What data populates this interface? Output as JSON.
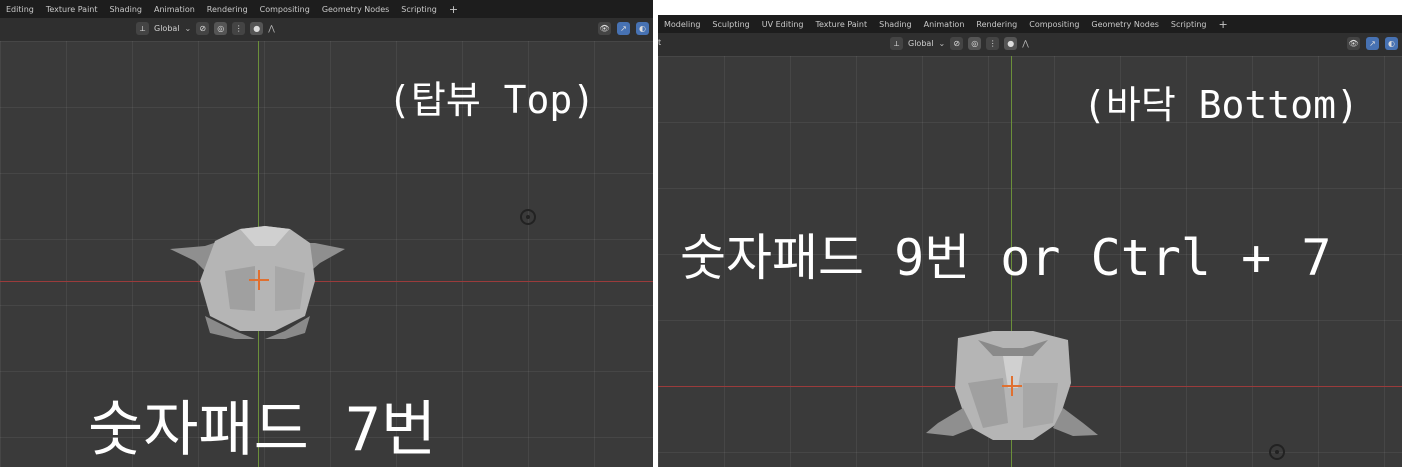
{
  "left_panel": {
    "menu_tabs": [
      "Editing",
      "Texture Paint",
      "Shading",
      "Animation",
      "Rendering",
      "Compositing",
      "Geometry Nodes",
      "Scripting"
    ],
    "plus": "+",
    "transform_orientation": "Global",
    "view_label": "(탑뷰 Top)",
    "shortcut_label": "숫자패드 7번"
  },
  "right_panel": {
    "menu_tabs": [
      "Modeling",
      "Sculpting",
      "UV Editing",
      "Texture Paint",
      "Shading",
      "Animation",
      "Rendering",
      "Compositing",
      "Geometry Nodes",
      "Scripting"
    ],
    "plus": "+",
    "edge_fragment": "t",
    "transform_orientation": "Global",
    "view_label": "(바닥 Bottom)",
    "shortcut_label": "숫자패드 9번 or Ctrl + 7"
  },
  "icons": {
    "transform": "transform-orientation-icon",
    "pivot": "pivot-point-icon",
    "snap": "snap-icon",
    "proportional": "proportional-editing-icon",
    "visibility": "object-visibility-icon",
    "gizmo": "gizmo-icon",
    "overlay": "overlay-icon",
    "light": "light-object-icon",
    "cursor": "3d-cursor-icon"
  },
  "colors": {
    "viewport_bg": "#3a3a3a",
    "x_axis": "#9a3b3b",
    "y_axis": "#6b8f3a",
    "header_active": "#4772b3",
    "mesh": "#b5b5b5"
  }
}
